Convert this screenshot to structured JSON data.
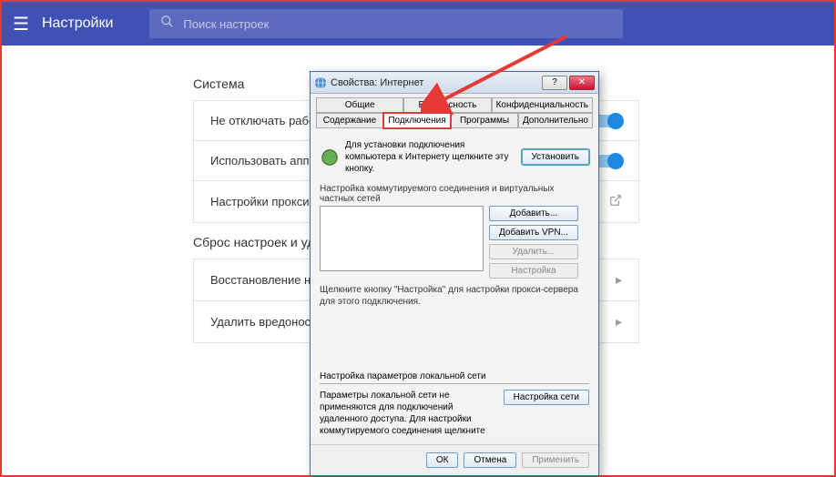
{
  "header": {
    "title": "Настройки",
    "search_placeholder": "Поиск настроек"
  },
  "sections": {
    "system_title": "Система",
    "reset_title": "Сброс настроек и уд"
  },
  "rows": {
    "row1": "Не отключать рабо",
    "row2": "Использовать аппа",
    "row3": "Настройки прокси-",
    "row4": "Восстановление на",
    "row5": "Удалить вредоносн"
  },
  "dialog": {
    "title": "Свойства: Интернет",
    "tabs": {
      "tab1": "Общие",
      "tab2": "Безопасность",
      "tab3": "Конфиденциальность",
      "tab4": "Содержание",
      "tab5": "Подключения",
      "tab6": "Программы",
      "tab7": "Дополнительно"
    },
    "install_text": "Для установки подключения компьютера к Интернету щелкните эту кнопку.",
    "install_btn": "Установить",
    "group_label": "Настройка коммутируемого соединения и виртуальных частных сетей",
    "add_btn": "Добавить...",
    "add_vpn_btn": "Добавить VPN...",
    "remove_btn": "Удалить...",
    "settings_btn": "Настройка",
    "hint": "Щелкните кнопку \"Настройка\" для настройки прокси-сервера для этого подключения.",
    "lan_label": "Настройка параметров локальной сети",
    "lan_text": "Параметры локальной сети не применяются для подключений удаленного доступа. Для настройки коммутируемого соединения щелкните кнопку \"Настройка\", расположенную выше.",
    "lan_btn": "Настройка сети",
    "ok": "ОК",
    "cancel": "Отмена",
    "apply": "Применить"
  }
}
